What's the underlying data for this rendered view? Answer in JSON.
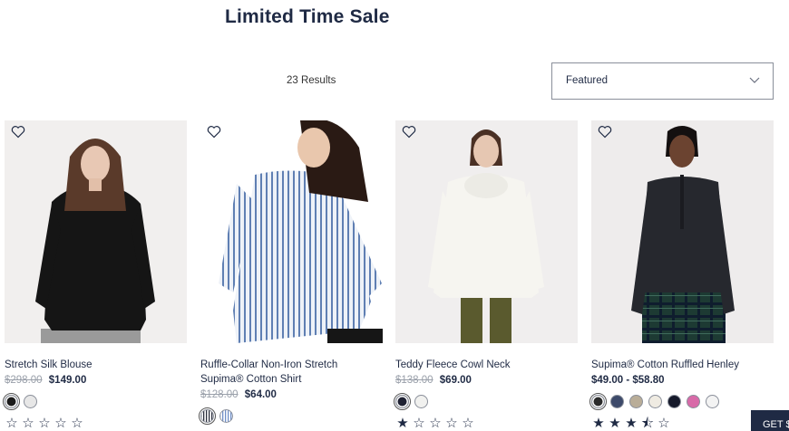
{
  "header": {
    "title": "Limited Time Sale"
  },
  "results": {
    "count_text": "23 Results"
  },
  "sort": {
    "selected": "Featured",
    "icon": "chevron-down-icon"
  },
  "products": [
    {
      "name": "Stretch Silk Blouse",
      "was_price": "$298.00",
      "price": "$149.00",
      "swatches": [
        "#1b1b1b",
        "#e7e7e7"
      ],
      "rating_stars": "☆☆☆☆☆"
    },
    {
      "name": "Ruffle-Collar Non-Iron Stretch Supima® Cotton Shirt",
      "was_price": "$128.00",
      "price": "$64.00",
      "swatches": [
        "stripe-navy",
        "stripe-blue"
      ],
      "rating_stars": ""
    },
    {
      "name": "Teddy Fleece Cowl Neck",
      "was_price": "$138.00",
      "price": "$69.00",
      "swatches": [
        "#1f2233",
        "#f1f1ef"
      ],
      "rating_stars": "★☆☆☆☆"
    },
    {
      "name": "Supima® Cotton Ruffled Henley",
      "price_range": "$49.00 - $58.80",
      "swatches": [
        "#2a2a2a",
        "#3d4a6a",
        "#b9ad98",
        "#efebe2",
        "#161a2b",
        "#d86aa8",
        "#f3f3f3"
      ],
      "rating_stars": "★★★⯪☆"
    }
  ],
  "cta": {
    "label": "GET $"
  }
}
